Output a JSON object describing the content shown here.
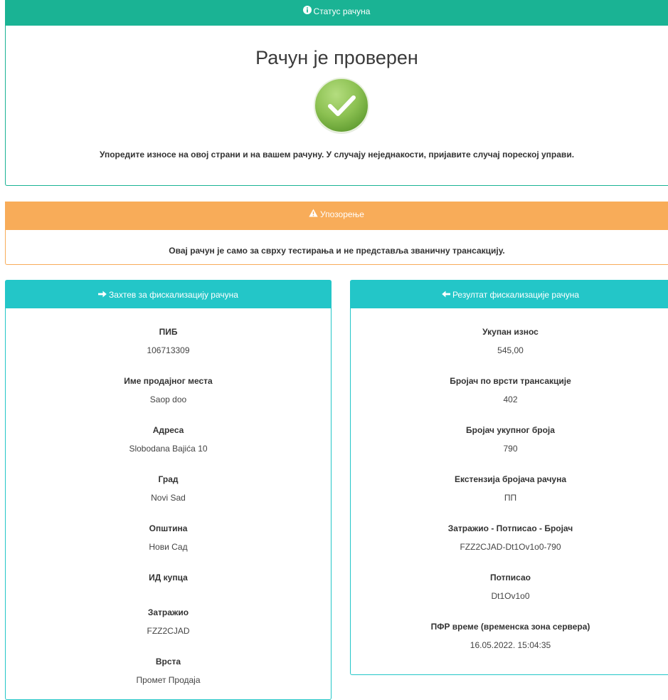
{
  "status": {
    "header": "Статус рачуна",
    "title": "Рачун је проверен",
    "message": "Упоредите износе на овој страни и на вашем рачуну. У случају неједнакости, пријавите случај пореској управи."
  },
  "warning": {
    "header": "Упозорење",
    "text": "Овај рачун је само за сврху тестирања и не представља званичну трансакцију."
  },
  "request": {
    "header": "Захтев за фискализацију рачуна",
    "fields": [
      {
        "label": "ПИБ",
        "value": "106713309"
      },
      {
        "label": "Име продајног места",
        "value": "Saop doo"
      },
      {
        "label": "Адреса",
        "value": "Slobodana Bajića 10"
      },
      {
        "label": "Град",
        "value": "Novi Sad"
      },
      {
        "label": "Општина",
        "value": "Нови Сад"
      },
      {
        "label": "ИД купца",
        "value": ""
      },
      {
        "label": "Затражио",
        "value": "FZZ2CJAD"
      },
      {
        "label": "Врста",
        "value": "Промет Продаја"
      }
    ]
  },
  "result": {
    "header": "Резултат фискализације рачуна",
    "fields": [
      {
        "label": "Укупан износ",
        "value": "545,00"
      },
      {
        "label": "Бројач по врсти трансакције",
        "value": "402"
      },
      {
        "label": "Бројач укупног броја",
        "value": "790"
      },
      {
        "label": "Екстензија бројача рачуна",
        "value": "ПП"
      },
      {
        "label": "Затражио - Потписао - Бројач",
        "value": "FZZ2CJAD-Dt1Ov1o0-790"
      },
      {
        "label": "Потписао",
        "value": "Dt1Ov1o0"
      },
      {
        "label": "ПФР време (временска зона сервера)",
        "value": "16.05.2022. 15:04:35"
      }
    ]
  },
  "colors": {
    "status_header": "#1ab394",
    "warning_header": "#f8ac59",
    "detail_header": "#23c6c8",
    "check_badge": "#8cc152"
  },
  "icons": {
    "status": "info-circle-icon",
    "warning": "warning-triangle-icon",
    "request": "arrow-right-icon",
    "result": "arrow-left-icon",
    "badge": "checkmark-icon"
  }
}
